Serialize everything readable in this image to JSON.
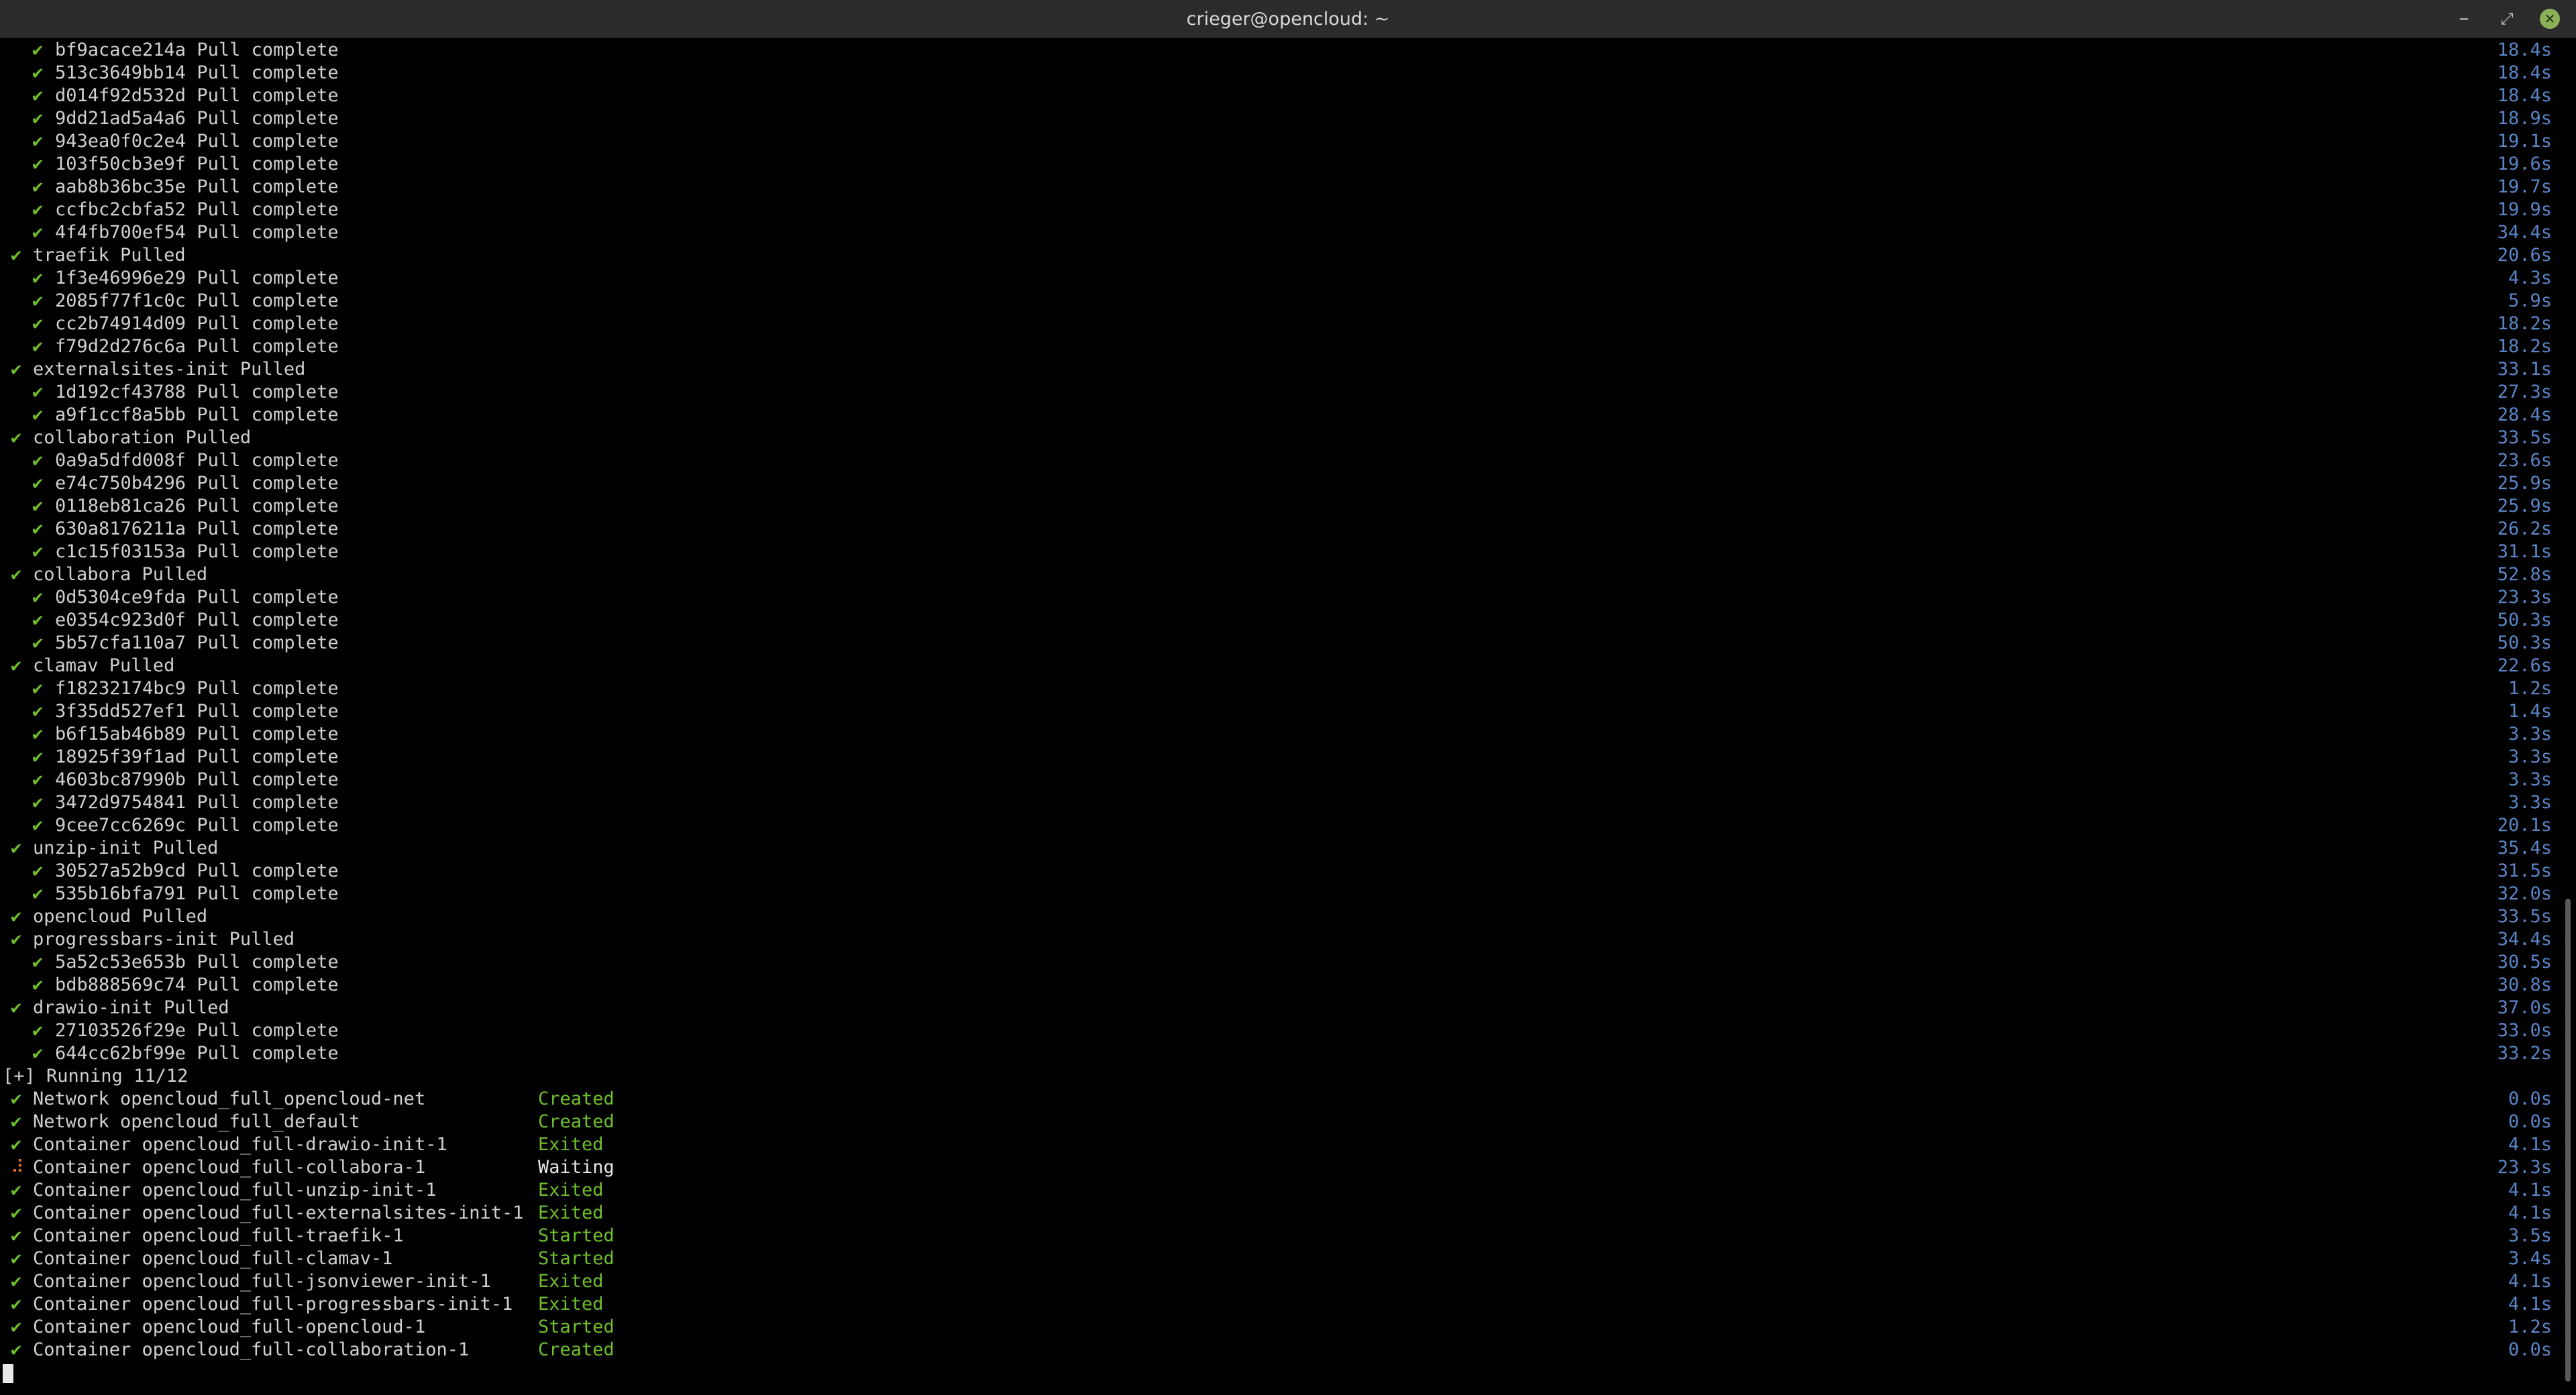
{
  "window": {
    "title": "crieger@opencloud: ~",
    "icons": {
      "minimize": "minimize-icon",
      "maximize": "maximize-icon",
      "close": "close-icon"
    }
  },
  "colors": {
    "check": "#6fbf2a",
    "time": "#5a86c8",
    "waiting_icon": "#e06c2a",
    "background": "#000000"
  },
  "terminal": {
    "lines": [
      {
        "kind": "layer",
        "icon": "✔",
        "text": "bf9acace214a Pull complete",
        "time": "18.4s"
      },
      {
        "kind": "layer",
        "icon": "✔",
        "text": "513c3649bb14 Pull complete",
        "time": "18.4s"
      },
      {
        "kind": "layer",
        "icon": "✔",
        "text": "d014f92d532d Pull complete",
        "time": "18.4s"
      },
      {
        "kind": "layer",
        "icon": "✔",
        "text": "9dd21ad5a4a6 Pull complete",
        "time": "18.9s"
      },
      {
        "kind": "layer",
        "icon": "✔",
        "text": "943ea0f0c2e4 Pull complete",
        "time": "19.1s"
      },
      {
        "kind": "layer",
        "icon": "✔",
        "text": "103f50cb3e9f Pull complete",
        "time": "19.6s"
      },
      {
        "kind": "layer",
        "icon": "✔",
        "text": "aab8b36bc35e Pull complete",
        "time": "19.7s"
      },
      {
        "kind": "layer",
        "icon": "✔",
        "text": "ccfbc2cbfa52 Pull complete",
        "time": "19.9s"
      },
      {
        "kind": "layer",
        "icon": "✔",
        "text": "4f4fb700ef54 Pull complete",
        "time": "34.4s"
      },
      {
        "kind": "image",
        "icon": "✔",
        "text": "traefik Pulled",
        "time": "20.6s"
      },
      {
        "kind": "layer",
        "icon": "✔",
        "text": "1f3e46996e29 Pull complete",
        "time": "4.3s"
      },
      {
        "kind": "layer",
        "icon": "✔",
        "text": "2085f77f1c0c Pull complete",
        "time": "5.9s"
      },
      {
        "kind": "layer",
        "icon": "✔",
        "text": "cc2b74914d09 Pull complete",
        "time": "18.2s"
      },
      {
        "kind": "layer",
        "icon": "✔",
        "text": "f79d2d276c6a Pull complete",
        "time": "18.2s"
      },
      {
        "kind": "image",
        "icon": "✔",
        "text": "externalsites-init Pulled",
        "time": "33.1s"
      },
      {
        "kind": "layer",
        "icon": "✔",
        "text": "1d192cf43788 Pull complete",
        "time": "27.3s"
      },
      {
        "kind": "layer",
        "icon": "✔",
        "text": "a9f1ccf8a5bb Pull complete",
        "time": "28.4s"
      },
      {
        "kind": "image",
        "icon": "✔",
        "text": "collaboration Pulled",
        "time": "33.5s"
      },
      {
        "kind": "layer",
        "icon": "✔",
        "text": "0a9a5dfd008f Pull complete",
        "time": "23.6s"
      },
      {
        "kind": "layer",
        "icon": "✔",
        "text": "e74c750b4296 Pull complete",
        "time": "25.9s"
      },
      {
        "kind": "layer",
        "icon": "✔",
        "text": "0118eb81ca26 Pull complete",
        "time": "25.9s"
      },
      {
        "kind": "layer",
        "icon": "✔",
        "text": "630a8176211a Pull complete",
        "time": "26.2s"
      },
      {
        "kind": "layer",
        "icon": "✔",
        "text": "c1c15f03153a Pull complete",
        "time": "31.1s"
      },
      {
        "kind": "image",
        "icon": "✔",
        "text": "collabora Pulled",
        "time": "52.8s"
      },
      {
        "kind": "layer",
        "icon": "✔",
        "text": "0d5304ce9fda Pull complete",
        "time": "23.3s"
      },
      {
        "kind": "layer",
        "icon": "✔",
        "text": "e0354c923d0f Pull complete",
        "time": "50.3s"
      },
      {
        "kind": "layer",
        "icon": "✔",
        "text": "5b57cfa110a7 Pull complete",
        "time": "50.3s"
      },
      {
        "kind": "image",
        "icon": "✔",
        "text": "clamav Pulled",
        "time": "22.6s"
      },
      {
        "kind": "layer",
        "icon": "✔",
        "text": "f18232174bc9 Pull complete",
        "time": "1.2s"
      },
      {
        "kind": "layer",
        "icon": "✔",
        "text": "3f35dd527ef1 Pull complete",
        "time": "1.4s"
      },
      {
        "kind": "layer",
        "icon": "✔",
        "text": "b6f15ab46b89 Pull complete",
        "time": "3.3s"
      },
      {
        "kind": "layer",
        "icon": "✔",
        "text": "18925f39f1ad Pull complete",
        "time": "3.3s"
      },
      {
        "kind": "layer",
        "icon": "✔",
        "text": "4603bc87990b Pull complete",
        "time": "3.3s"
      },
      {
        "kind": "layer",
        "icon": "✔",
        "text": "3472d9754841 Pull complete",
        "time": "3.3s"
      },
      {
        "kind": "layer",
        "icon": "✔",
        "text": "9cee7cc6269c Pull complete",
        "time": "20.1s"
      },
      {
        "kind": "image",
        "icon": "✔",
        "text": "unzip-init Pulled",
        "time": "35.4s"
      },
      {
        "kind": "layer",
        "icon": "✔",
        "text": "30527a52b9cd Pull complete",
        "time": "31.5s"
      },
      {
        "kind": "layer",
        "icon": "✔",
        "text": "535b16bfa791 Pull complete",
        "time": "32.0s"
      },
      {
        "kind": "image",
        "icon": "✔",
        "text": "opencloud Pulled",
        "time": "33.5s"
      },
      {
        "kind": "image",
        "icon": "✔",
        "text": "progressbars-init Pulled",
        "time": "34.4s"
      },
      {
        "kind": "layer",
        "icon": "✔",
        "text": "5a52c53e653b Pull complete",
        "time": "30.5s"
      },
      {
        "kind": "layer",
        "icon": "✔",
        "text": "bdb888569c74 Pull complete",
        "time": "30.8s"
      },
      {
        "kind": "image",
        "icon": "✔",
        "text": "drawio-init Pulled",
        "time": "37.0s"
      },
      {
        "kind": "layer",
        "icon": "✔",
        "text": "27103526f29e Pull complete",
        "time": "33.0s"
      },
      {
        "kind": "layer",
        "icon": "✔",
        "text": "644cc62bf99e Pull complete",
        "time": "33.2s"
      },
      {
        "kind": "running",
        "text": "[+] Running 11/12"
      },
      {
        "kind": "resource",
        "icon": "✔",
        "text": "Network opencloud_full_opencloud-net",
        "status": "Created",
        "time": "0.0s"
      },
      {
        "kind": "resource",
        "icon": "✔",
        "text": "Network opencloud_full_default",
        "status": "Created",
        "time": "0.0s"
      },
      {
        "kind": "resource",
        "icon": "✔",
        "text": "Container opencloud_full-drawio-init-1",
        "status": "Exited",
        "time": "4.1s"
      },
      {
        "kind": "resource",
        "icon": "⠼",
        "text": "Container opencloud_full-collabora-1",
        "status": "Waiting",
        "time": "23.3s"
      },
      {
        "kind": "resource",
        "icon": "✔",
        "text": "Container opencloud_full-unzip-init-1",
        "status": "Exited",
        "time": "4.1s"
      },
      {
        "kind": "resource",
        "icon": "✔",
        "text": "Container opencloud_full-externalsites-init-1",
        "status": "Exited",
        "time": "4.1s"
      },
      {
        "kind": "resource",
        "icon": "✔",
        "text": "Container opencloud_full-traefik-1",
        "status": "Started",
        "time": "3.5s"
      },
      {
        "kind": "resource",
        "icon": "✔",
        "text": "Container opencloud_full-clamav-1",
        "status": "Started",
        "time": "3.4s"
      },
      {
        "kind": "resource",
        "icon": "✔",
        "text": "Container opencloud_full-jsonviewer-init-1",
        "status": "Exited",
        "time": "4.1s"
      },
      {
        "kind": "resource",
        "icon": "✔",
        "text": "Container opencloud_full-progressbars-init-1",
        "status": "Exited",
        "time": "4.1s"
      },
      {
        "kind": "resource",
        "icon": "✔",
        "text": "Container opencloud_full-opencloud-1",
        "status": "Started",
        "time": "1.2s"
      },
      {
        "kind": "resource",
        "icon": "✔",
        "text": "Container opencloud_full-collaboration-1",
        "status": "Created",
        "time": "0.0s"
      },
      {
        "kind": "prompt"
      }
    ]
  }
}
